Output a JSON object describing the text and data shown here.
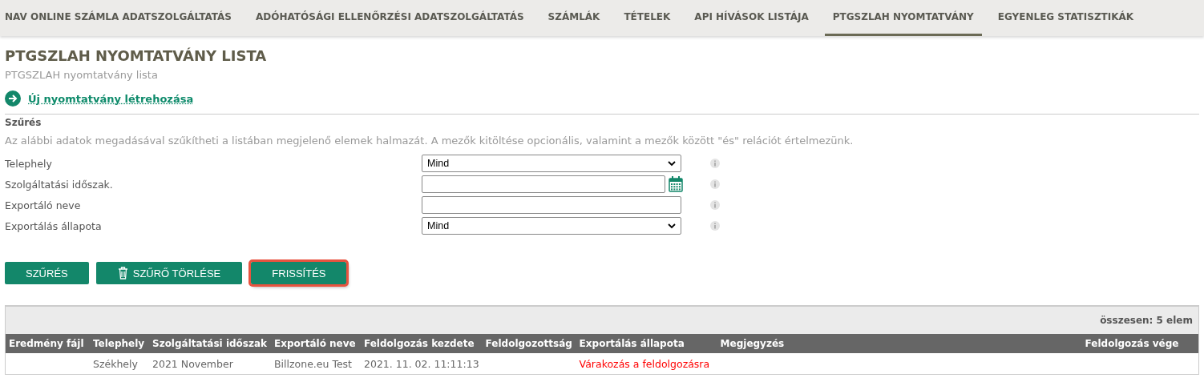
{
  "nav": {
    "tabs": [
      {
        "label": "NAV ONLINE SZÁMLA ADATSZOLGÁLTATÁS",
        "selected": false
      },
      {
        "label": "ADÓHATÓSÁGI ELLENŐRZÉSI ADATSZOLGÁLTATÁS",
        "selected": false
      },
      {
        "label": "SZÁMLÁK",
        "selected": false
      },
      {
        "label": "TÉTELEK",
        "selected": false
      },
      {
        "label": "API HÍVÁSOK LISTÁJA",
        "selected": false
      },
      {
        "label": "PTGSZLAH NYOMTATVÁNY",
        "selected": true
      },
      {
        "label": "EGYENLEG STATISZTIKÁK",
        "selected": false
      }
    ]
  },
  "page": {
    "title": "PTGSZLAH NYOMTATVÁNY LISTA",
    "subtitle": "PTGSZLAH nyomtatvány lista",
    "create_link": "Új nyomtatvány létrehozása"
  },
  "filter": {
    "heading": "Szűrés",
    "description": "Az alábbi adatok megadásával szűkítheti a listában megjelenő elemek halmazát. A mezők kitöltése opcionális, valamint a mezők között \"és\" relációt értelmezünk.",
    "fields": [
      {
        "label": "Telephely",
        "kind": "select",
        "value": "Mind"
      },
      {
        "label": "Szolgáltatási időszak.",
        "kind": "date"
      },
      {
        "label": "Exportáló neve",
        "kind": "text"
      },
      {
        "label": "Exportálás állapota",
        "kind": "select",
        "value": "Mind"
      }
    ],
    "buttons": [
      {
        "label": "SZŰRÉS",
        "kind": "plain",
        "highlighted": false
      },
      {
        "label": "SZŰRŐ TÖRLÉSE",
        "kind": "trash",
        "highlighted": false
      },
      {
        "label": "FRISSÍTÉS",
        "kind": "plain",
        "highlighted": true
      }
    ]
  },
  "table": {
    "summary": "összesen: 5 elem",
    "columns": [
      "Eredmény fájl",
      "Telephely",
      "Szolgáltatási időszak",
      "Exportáló neve",
      "Feldolgozás kezdete",
      "Feldolgozottság",
      "Exportálás állapota",
      "Megjegyzés",
      "Feldolgozás vége"
    ],
    "rows": [
      {
        "cells": [
          "",
          "Székhely",
          "2021 November",
          "Billzone.eu Test",
          "2021. 11. 02. 11:11:13",
          "",
          {
            "text": "Várakozás a feldolgozásra",
            "color": "#ff0000"
          },
          "",
          ""
        ]
      }
    ]
  }
}
